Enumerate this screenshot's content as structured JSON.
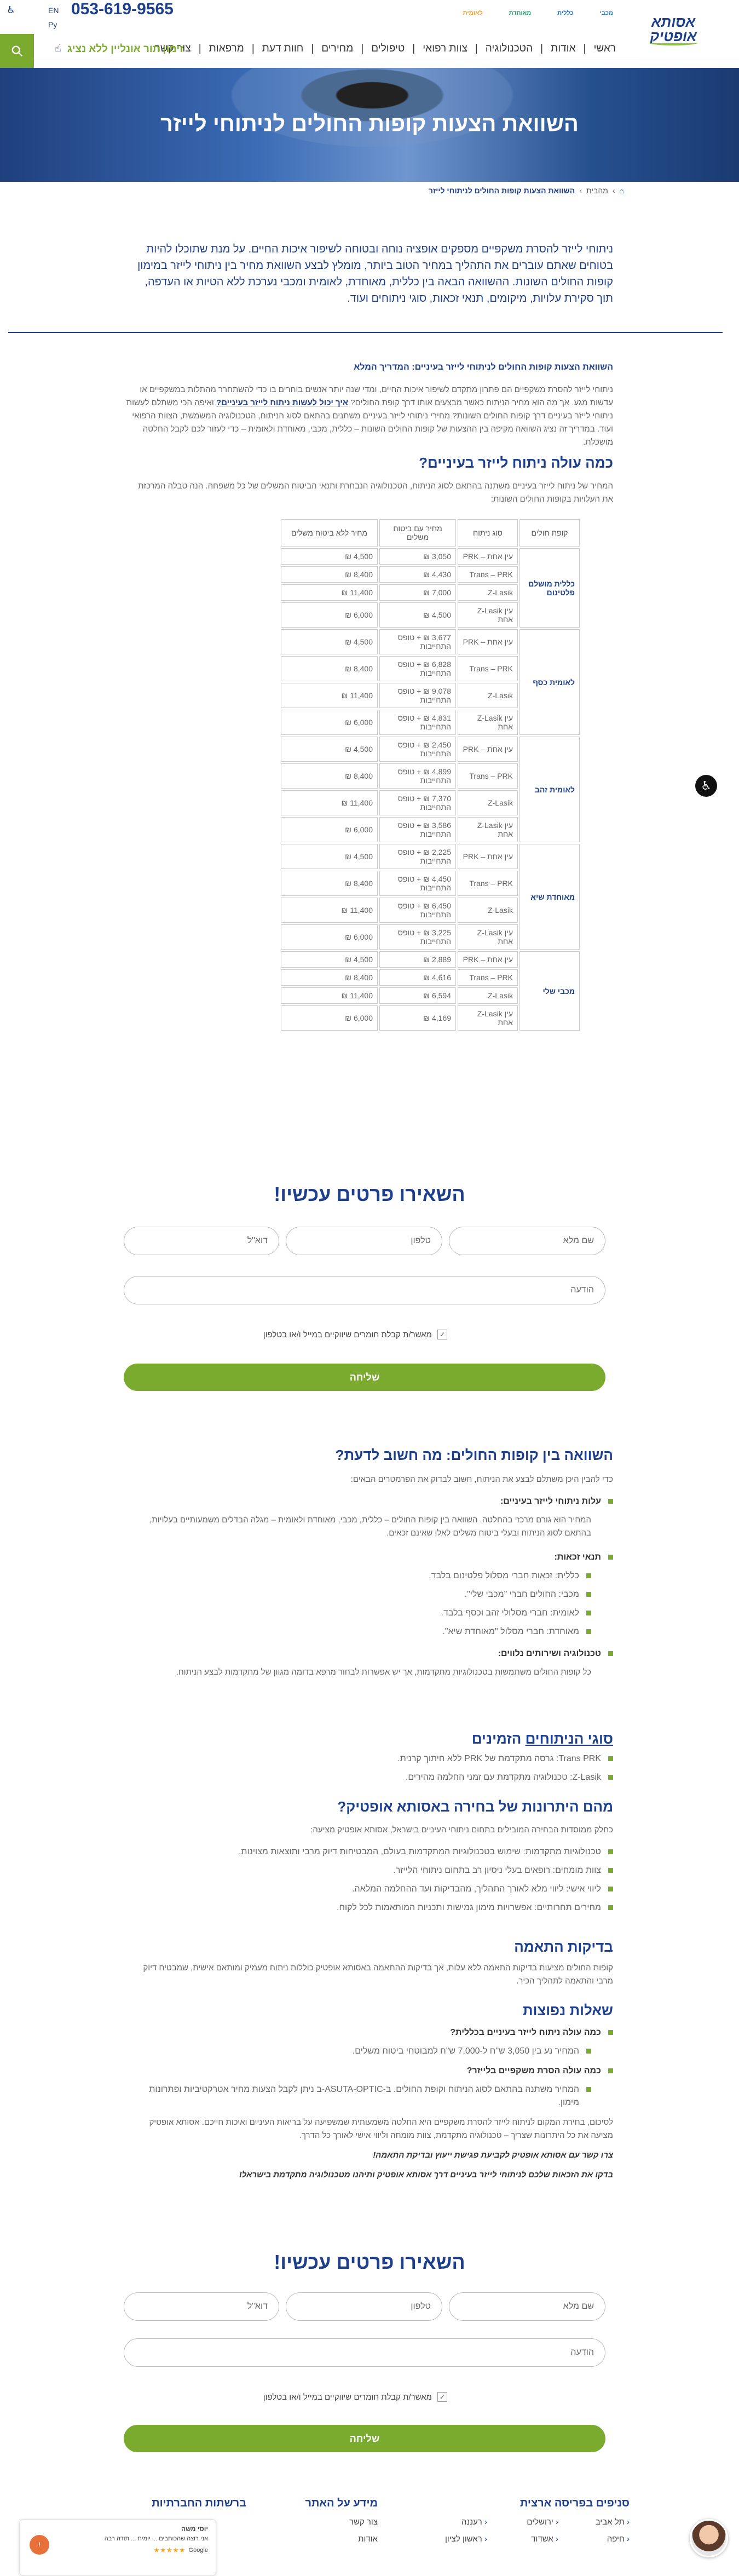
{
  "header": {
    "phone": "053-619-9565",
    "lang_en": "EN",
    "lang_ru": "Py",
    "logo_line1": "אסותא",
    "logo_line2": "אופטיק",
    "partners": [
      "מכבי",
      "כללית",
      "מאוחדת",
      "לאומית"
    ],
    "nav": [
      "ראשי",
      "אודות",
      "הטכנולוגיה",
      "צוות רפואי",
      "טיפולים",
      "מחירים",
      "חוות דעת",
      "מרפאות",
      "צור קשר"
    ],
    "booking": "זימון תור אונליין ללא נציג"
  },
  "hero": {
    "title": "השוואת הצעות קופות החולים לניתוחי לייזר"
  },
  "breadcrumb": {
    "items": [
      "מהבית",
      "השוואת הצעות קופות החולים לניתוחי לייזר"
    ]
  },
  "intro": "ניתוחי לייזר להסרת משקפיים מספקים אופציה נוחה ובטוחה לשיפור איכות החיים. על מנת שתוכלו להיות בטוחים שאתם עוברים את התהליך במחיר הטוב ביותר, מומלץ לבצע השוואת מחיר בין ניתוחי לייזר במימון קופות החולים השונות. ההשוואה הבאה בין כללית, מאוחדת, לאומית ומכבי נערכת ללא הטיות או העדפה, תוך סקירת עלויות, מיקומים, תנאי זכאות, סוגי ניתוחים ועוד.",
  "guide": {
    "title": "השוואת הצעות קופות החולים לניתוחי לייזר בעיניים: המדריך המלא",
    "text": "ניתוחי לייזר להסרת משקפיים הם פתרון מתקדם לשיפור איכות החיים, ומדי שנה יותר אנשים בוחרים בו כדי להשתחרר מהתלות במשקפיים או עדשות מגע. אך מה הוא מחיר הניתוח כאשר מבצעים אותו דרך קופת החולים?",
    "link": "איך יכול לעשות ניתוח לייזר בעיניים?",
    "text2": "ואיפה הכי משתלם לעשות ניתוחי לייזר בעיניים דרך קופות החולים השונות? מחירי ניתוחי לייזר בעיניים משתנים בהתאם לסוג הניתוח, הטכנולוגיה המשמשת, הצוות הרפואי ועוד. במדריך זה נציג השוואה מקיפה בין ההצעות של קופות החולים השונות – כללית, מכבי, מאוחדת ולאומית – כדי לעזור לכם לקבל החלטה מושכלת."
  },
  "cost_section": {
    "title": "כמה עולה ניתוח לייזר בעיניים?",
    "text": "המחיר של ניתוח לייזר בעיניים משתנה בהתאם לסוג הניתוח, הטכנולוגיה הנבחרת ותנאי הביטוח המשלים של כל משפחה. הנה טבלה המרכזת את העלויות בקופות החולים השונות:"
  },
  "table": {
    "headers": [
      "קופת חולים",
      "סוג ניתוח",
      "מחיר עם ביטוח משלים",
      "מחיר ללא ביטוח משלים"
    ],
    "groups": [
      {
        "fund": "כללית מושלם פלטינום",
        "rows": [
          [
            "PRK – עין אחת",
            "3,050 ₪",
            "4,500 ₪"
          ],
          [
            "Trans – PRK",
            "4,430 ₪",
            "8,400 ₪"
          ],
          [
            "Z-Lasik",
            "7,000 ₪",
            "11,400 ₪"
          ],
          [
            "Z-Lasik עין אחת",
            "4,500 ₪",
            "6,000 ₪"
          ]
        ]
      },
      {
        "fund": "לאומית כסף",
        "rows": [
          [
            "PRK – עין אחת",
            "3,677 ₪ + טופס התחייבות",
            "4,500 ₪"
          ],
          [
            "Trans – PRK",
            "6,828 ₪ + טופס התחייבות",
            "8,400 ₪"
          ],
          [
            "Z-Lasik",
            "9,078 ₪ + טופס התחייבות",
            "11,400 ₪"
          ],
          [
            "Z-Lasik עין אחת",
            "4,831 ₪ + טופס התחייבות",
            "6,000 ₪"
          ]
        ]
      },
      {
        "fund": "לאומית זהב",
        "rows": [
          [
            "PRK – עין אחת",
            "2,450 ₪ + טופס התחייבות",
            "4,500 ₪"
          ],
          [
            "Trans – PRK",
            "4,899 ₪ + טופס התחייבות",
            "8,400 ₪"
          ],
          [
            "Z-Lasik",
            "7,370 ₪ + טופס התחייבות",
            "11,400 ₪"
          ],
          [
            "Z-Lasik עין אחת",
            "3,586 ₪ + טופס התחייבות",
            "6,000 ₪"
          ]
        ]
      },
      {
        "fund": "מאוחדת שיא",
        "rows": [
          [
            "PRK – עין אחת",
            "2,225 ₪ + טופס התחייבות",
            "4,500 ₪"
          ],
          [
            "Trans – PRK",
            "4,450 ₪ + טופס התחייבות",
            "8,400 ₪"
          ],
          [
            "Z-Lasik",
            "6,450 ₪ + טופס התחייבות",
            "11,400 ₪"
          ],
          [
            "Z-Lasik עין אחת",
            "3,225 ₪ + טופס התחייבות",
            "6,000 ₪"
          ]
        ]
      },
      {
        "fund": "מכבי שלי",
        "rows": [
          [
            "PRK – עין אחת",
            "2,889 ₪",
            "4,500 ₪"
          ],
          [
            "Trans – PRK",
            "4,616 ₪",
            "8,400 ₪"
          ],
          [
            "Z-Lasik",
            "6,594 ₪",
            "11,400 ₪"
          ],
          [
            "Z-Lasik עין אחת",
            "4,169 ₪",
            "6,000 ₪"
          ]
        ]
      }
    ]
  },
  "form": {
    "title": "השאירו פרטים עכשיו!",
    "name_ph": "שם מלא",
    "phone_ph": "טלפון",
    "email_ph": "דוא\"ל",
    "message_ph": "הודעה",
    "consent": "מאשר/ת קבלת חומרים שיווקיים במייל ו/או בטלפון",
    "submit": "שליחה"
  },
  "compare": {
    "title": "השוואה בין קופות החולים: מה חשוב לדעת?",
    "intro": "כדי להבין היכן משתלם לבצע את הניתוח, חשוב לבדוק את הפרמטרים הבאים:",
    "b1_title": "עלות ניתוחי לייזר בעיניים:",
    "b1_text": "המחיר הוא גורם מרכזי בהחלטה. השוואה בין קופות החולים – כללית, מכבי, מאוחדת ולאומית – מגלה הבדלים משמעותיים בעלויות, בהתאם לסוג הניתוח ובעלי ביטוח משלים לאלו שאינם זכאים.",
    "b2_title": "תנאי זכאות:",
    "b2_items": [
      "כללית: זכאות חברי מסלול פלטינום בלבד.",
      "מכבי: החולים חברי \"מכבי שלי\".",
      "לאומית: חברי מסלולי זהב וכסף בלבד.",
      "מאוחדת: חברי מסלול \"מאוחדת שיא\"."
    ],
    "b3_title": "טכנולוגיה ושירותים נלווים:",
    "b3_text": "כל קופות החולים משתמשות בטכנולוגיות מתקדמות, אך יש אפשרות לבחור מרפא בדומה מגוון של מתקדמות לבצע הניתוח."
  },
  "types": {
    "title_a": "סוגי הניתוחים",
    "title_b": "הזמינים",
    "items": [
      "Trans PRK: גרסה מתקדמת של PRK ללא חיתוך קרנית.",
      "Z-Lasik: טכנולוגיה מתקדמת עם זמני החלמה מהירים."
    ]
  },
  "advantages": {
    "title": "מהם היתרונות של בחירה באסותא אופטיק?",
    "intro": "כחלק ממוסדות הבחירה המובילים בתחום ניתוחי העיניים בישראל, אסותא אופטיק מציעה:",
    "items": [
      "טכנולוגיות מתקדמות: שימוש בטכנולוגיות המתקדמות בעולם, המבטיחות דיוק מרבי ותוצאות מצוינות.",
      "צוות מומחים: רופאים בעלי ניסיון רב בתחום ניתוחי הלייזר.",
      "ליווי אישי: ליווי מלא לאורך התהליך, מהבדיקות ועד ההחלמה המלאה.",
      "מחירים תחרותיים: אפשרויות מימון גמישות ותכניות המותאמות לכל לקוח."
    ]
  },
  "eligibility": {
    "title": "בדיקות התאמה",
    "text": "קופות החולים מציעות בדיקות התאמה ללא עלות, אך בדיקות ההתאמה באסותא אופטיק כוללות ניתוח מעמיק ומותאם אישית, שמבטיח דיוק מרבי והתאמה לתהליך הכיר."
  },
  "faq": {
    "title": "שאלות נפוצות",
    "q1": "כמה עולה ניתוח לייזר בעיניים בכללית?",
    "a1": "המחיר נע בין 3,050 ש\"ח ל-7,000 ש\"ח למבוטחי ביטוח משלים.",
    "q2": "כמה עולה הסרת משקפיים בלייזר?",
    "a2": "המחיר משתנה בהתאם לסוג הניתוח וקופת החולים. ב-ASUTA-OPTIC-ב ניתן לקבל הצעות מחיר אטרקטיביות ופתרונות מימון.",
    "closing": "לסיכום, בחירת המקום לניתוח לייזר להסרת משקפיים היא החלטה משמעותית שמשפיעה על בריאות העיניים ואיכות חייכם. אסותא אופטיק מציעה את כל היתרונות שצריך – טכנולוגיה מתקדמת, צוות מומחה וליווי אישי לאורך כל הדרך.",
    "cta1": "צרו קשר עם אסותא אופטיק לקביעת פגישת ייעוץ ובדיקת התאמה!",
    "cta2": "בדקו את הזכאות שלכם לניתוחי לייזר בעיניים דרך אסותא אופטיק ותיהנו מטכנולוגיה מתקדמת בישראל!"
  },
  "footer": {
    "branches_title": "סניפים בפריסה ארצית",
    "branches": [
      "תל אביב",
      "ירושלים",
      "רעננה",
      "חיפה",
      "אשדוד",
      "ראשון לציון"
    ],
    "info_title": "מידע על האתר",
    "info": [
      "צור קשר",
      "אודות"
    ],
    "social_title": "ברשתות החברתיות"
  },
  "review": {
    "name": "יוסי משה",
    "text": "אני רוצה שהכותבים ... יומית ... תודה רבה",
    "source": "Google"
  },
  "colors": {
    "primary": "#1d3f8c",
    "accent": "#7aab2f"
  }
}
